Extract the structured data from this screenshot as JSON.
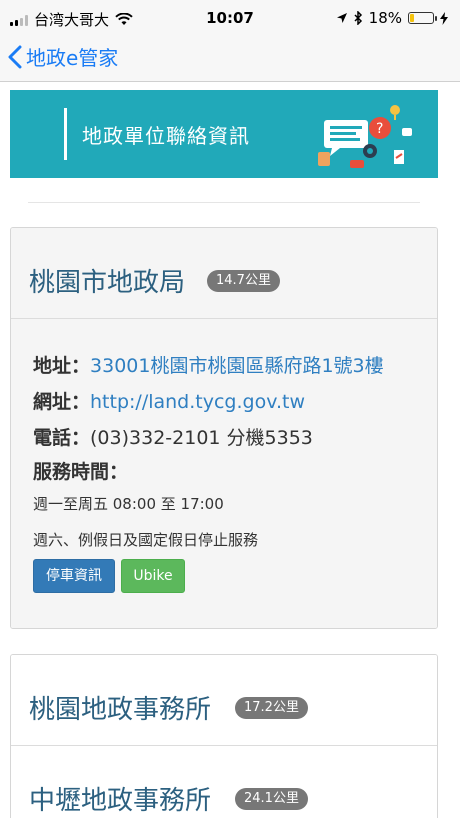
{
  "status": {
    "carrier": "台湾大哥大",
    "time": "10:07",
    "battery": "18%",
    "battery_level": 0.18
  },
  "nav": {
    "back_label": "地政e管家"
  },
  "banner": {
    "title": "地政單位聯絡資訊"
  },
  "offices": [
    {
      "name": "桃園市地政局",
      "distance": "14.7公里",
      "address_label": "地址：",
      "address": "33001桃園市桃園區縣府路1號3樓",
      "url_label": "網址：",
      "url": "http://land.tycg.gov.tw",
      "phone_label": "電話：",
      "phone": "(03)332-2101 分機5353",
      "hours_label": "服務時間：",
      "hours_weekday": "週一至周五 08:00 至 17:00",
      "hours_note": "週六、例假日及國定假日停止服務",
      "parking_button": "停車資訊",
      "ubike_button": "Ubike"
    },
    {
      "name": "桃園地政事務所",
      "distance": "17.2公里"
    },
    {
      "name": "中壢地政事務所",
      "distance": "24.1公里"
    }
  ]
}
